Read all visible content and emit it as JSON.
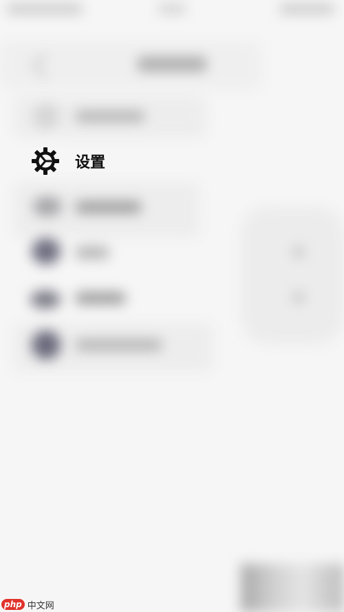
{
  "settings_item": {
    "label": "设置",
    "icon": "gear-icon"
  },
  "watermark": {
    "logo_text": "php",
    "site_text": "中文网"
  },
  "colors": {
    "background": "#f6f6f6",
    "label_color": "#111111",
    "watermark_red": "#e0332c"
  }
}
